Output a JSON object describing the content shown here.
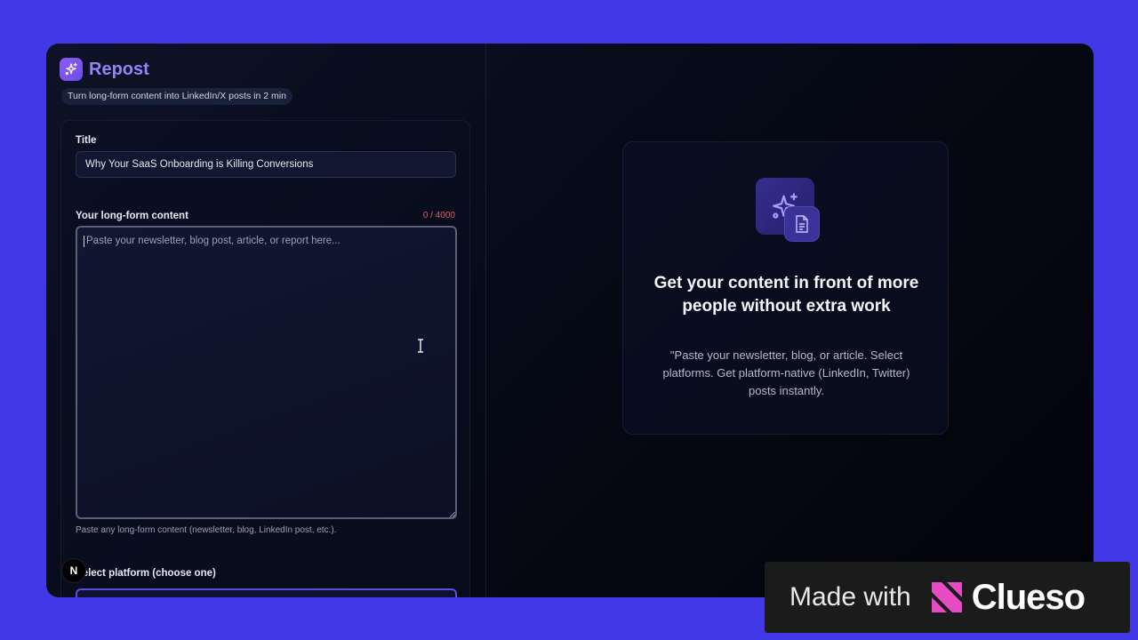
{
  "app": {
    "name": "Repost",
    "tagline": "Turn long-form content into LinkedIn/X posts in 2 min"
  },
  "form": {
    "title_label": "Title",
    "title_value": "Why Your SaaS Onboarding is Killing Conversions",
    "content_label": "Your long-form content",
    "content_counter": "0 / 4000",
    "content_placeholder": "Paste your newsletter, blog post, article, or report here...",
    "content_hint": "Paste any long-form content (newsletter, blog, LinkedIn post, etc.).",
    "platform_label": "Select platform (choose one)"
  },
  "empty_state": {
    "title": "Get your content in front of more people without extra work",
    "description": "\"Paste your newsletter, blog, or article. Select platforms. Get platform-native (LinkedIn, Twitter) posts instantly."
  },
  "overlay": {
    "n_badge": "N"
  },
  "watermark": {
    "prefix": "Made with",
    "brand": "Clueso"
  },
  "colors": {
    "background": "#4338e6",
    "accent": "#8f86f7",
    "counter": "#e25b63",
    "select_border": "#5b4fe0"
  }
}
